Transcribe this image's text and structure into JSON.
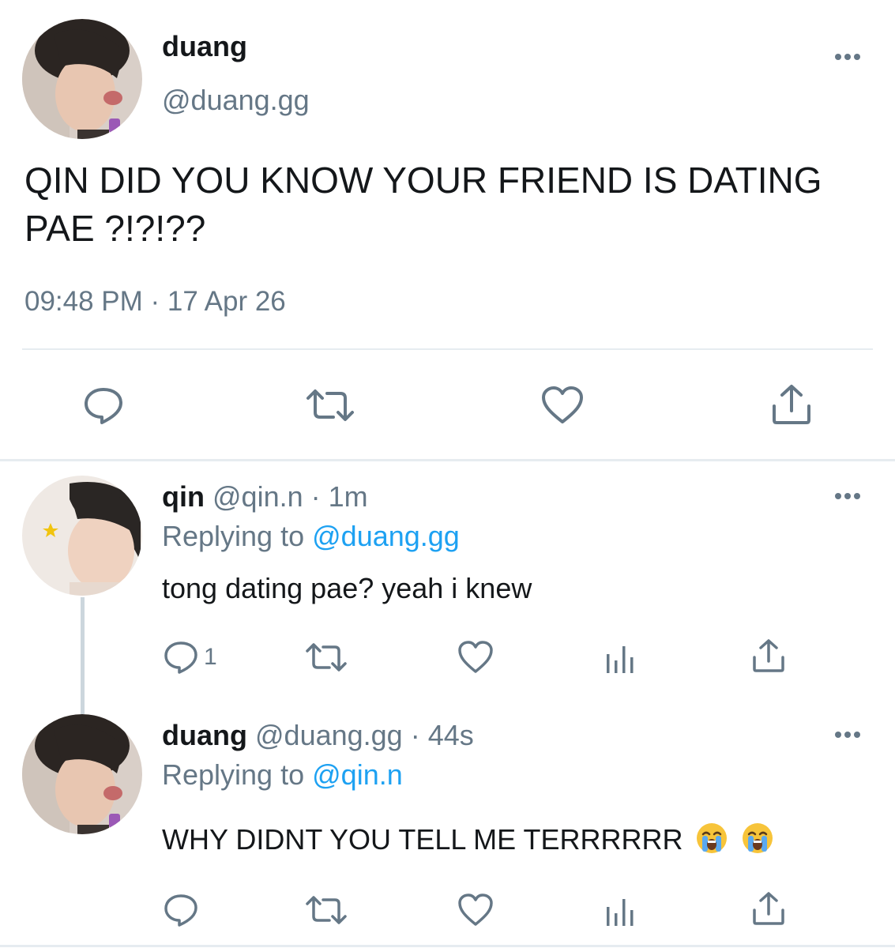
{
  "main_tweet": {
    "display_name": "duang",
    "handle": "@duang.gg",
    "text": "QIN DID YOU KNOW YOUR FRIEND IS DATING PAE ?!?!??",
    "timestamp": "09:48 PM · 17 Apr 26",
    "actions": [
      "reply-icon",
      "retweet-icon",
      "like-icon",
      "share-icon"
    ]
  },
  "replies": [
    {
      "display_name": "qin",
      "handle": "@qin.n",
      "separator": "·",
      "time_ago": "1m",
      "replying_prefix": "Replying to",
      "replying_to": "@duang.gg",
      "text": "tong dating pae? yeah i knew",
      "reply_count": "1"
    },
    {
      "display_name": "duang",
      "handle": "@duang.gg",
      "separator": "·",
      "time_ago": "44s",
      "replying_prefix": "Replying to",
      "replying_to": "@qin.n",
      "text": "WHY DIDNT YOU TELL ME TERRRRRR",
      "emojis": [
        "crying-face-emoji",
        "crying-face-emoji"
      ]
    }
  ],
  "colors": {
    "text": "#14171a",
    "muted": "#657786",
    "link": "#1da1f2",
    "divider": "#e6ecf0"
  }
}
